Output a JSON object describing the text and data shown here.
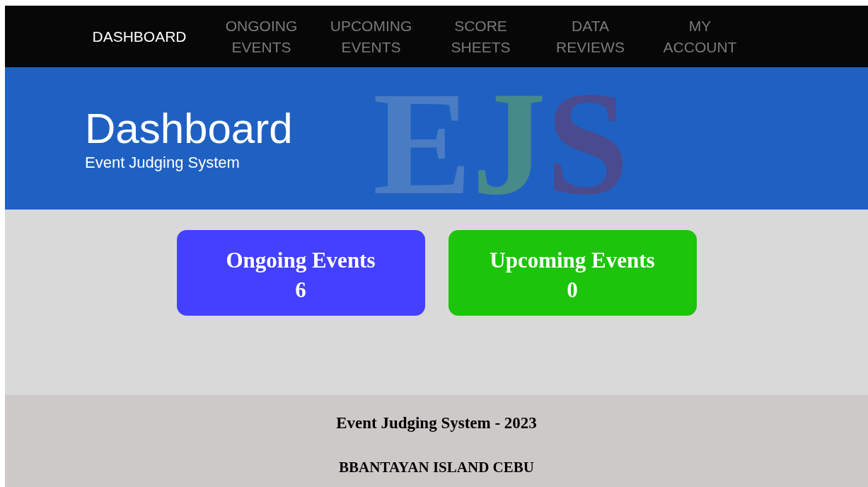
{
  "nav": [
    {
      "label": "DASHBOARD",
      "selected": true
    },
    {
      "label": "ONGOING EVENTS",
      "selected": false
    },
    {
      "label": "UPCOMING EVENTS",
      "selected": false
    },
    {
      "label": "SCORE SHEETS",
      "selected": false
    },
    {
      "label": "DATA REVIEWS",
      "selected": false
    },
    {
      "label": "MY ACCOUNT",
      "selected": false
    }
  ],
  "header": {
    "title": "Dashboard",
    "subtitle": "Event Judging System",
    "logo_letters": [
      {
        "text": "E",
        "color": "#4a7cc4"
      },
      {
        "text": "J",
        "color": "#478a8a"
      },
      {
        "text": "S",
        "color": "#4a4a8f"
      }
    ]
  },
  "cards": [
    {
      "label": "Ongoing Events",
      "count": "6",
      "color": "#4340ff"
    },
    {
      "label": "Upcoming Events",
      "count": "0",
      "color": "#1cc40b"
    }
  ],
  "footer": {
    "line_1": "Event Judging System - 2023",
    "line_2": "BBANTAYAN ISLAND CEBU"
  }
}
